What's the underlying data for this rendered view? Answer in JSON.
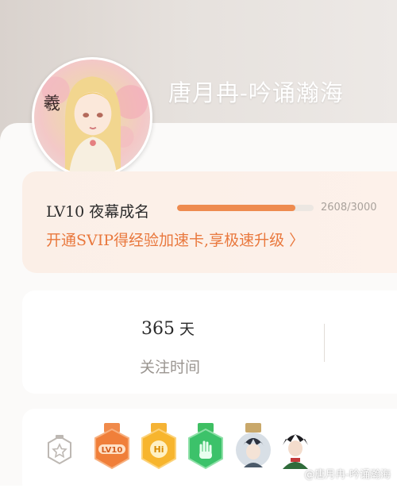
{
  "profile": {
    "username": "唐月冉-吟诵瀚海",
    "avatar_icon": "anime-portrait-avatar"
  },
  "level": {
    "name": "LV10 夜幕成名",
    "current": 2608,
    "max": 3000,
    "progress_text": "2608/3000",
    "progress_fraction": 0.869,
    "upgrade_link": "开通SVIP得经验加速卡,享极速升级 〉"
  },
  "stats": {
    "value": "365",
    "unit": "天",
    "label": "关注时间"
  },
  "badges": [
    {
      "name": "empty-badge-slot",
      "label": ""
    },
    {
      "name": "lv10-badge",
      "label": "LV10"
    },
    {
      "name": "hi-badge",
      "label": "Hi"
    },
    {
      "name": "hand-badge",
      "label": ""
    },
    {
      "name": "character-badge-1",
      "label": ""
    },
    {
      "name": "character-badge-2",
      "label": ""
    }
  ],
  "watermark": "@唐月冉-吟诵瀚海",
  "colors": {
    "accent": "#ee8b4f",
    "link": "#e9783d",
    "card_bg": "#fbefe7"
  }
}
